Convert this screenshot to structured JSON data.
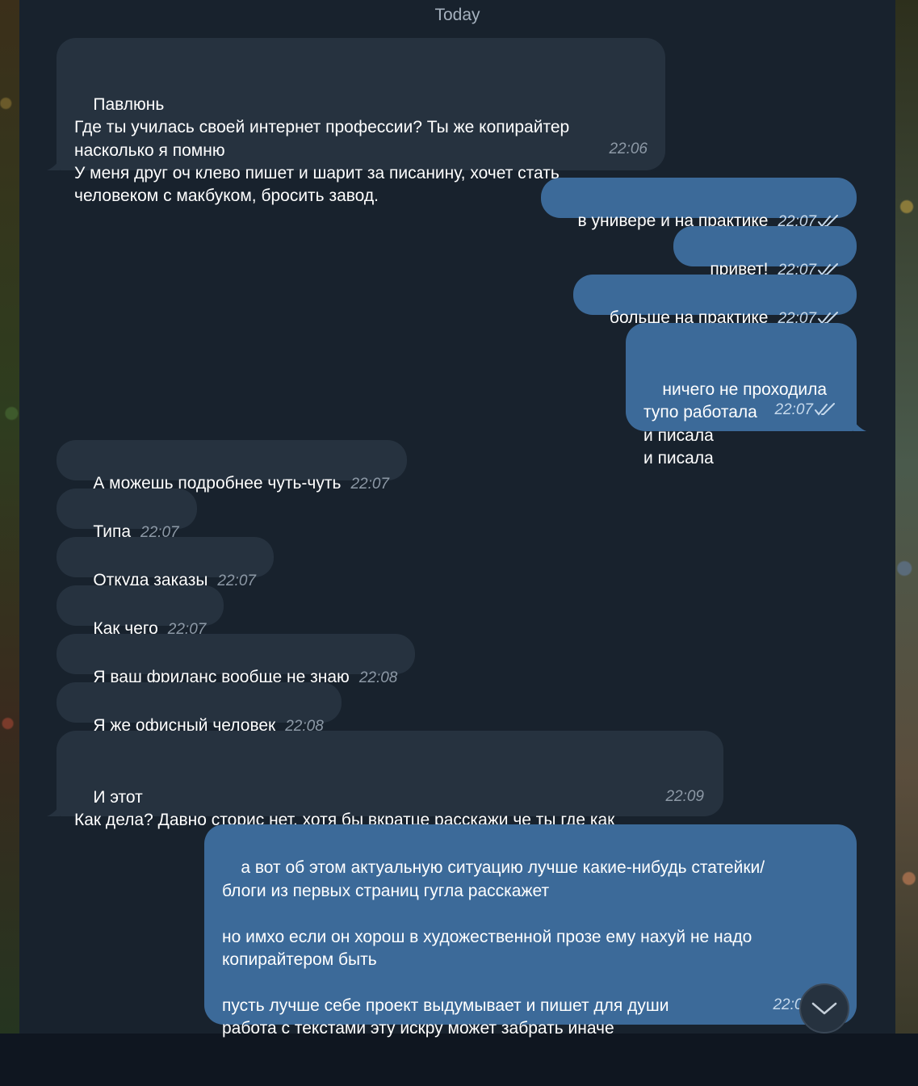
{
  "date_separator": "Today",
  "messages": [
    {
      "text": "Павлюнь\nГде ты училась своей интернет профессии? Ты же копирайтер насколько я помню\nУ меня друг оч клево пишет и шарит за писанину, хочет стать человеком с макбуком, бросить завод.",
      "time": "22:06"
    },
    {
      "text": "в универе и на практике",
      "time": "22:07"
    },
    {
      "text": "привет!",
      "time": "22:07"
    },
    {
      "text": "больше на практике",
      "time": "22:07"
    },
    {
      "text": "ничего не проходила\nтупо работала\nи писала\nи писала",
      "time": "22:07"
    },
    {
      "text": "А можешь подробнее чуть-чуть",
      "time": "22:07"
    },
    {
      "text": "Типа",
      "time": "22:07"
    },
    {
      "text": "Откуда заказы",
      "time": "22:07"
    },
    {
      "text": "Как чего",
      "time": "22:07"
    },
    {
      "text": "Я ваш фриланс вообще не знаю",
      "time": "22:08"
    },
    {
      "text": "Я же офисный человек",
      "time": "22:08"
    },
    {
      "text": "И этот\nКак дела? Давно сторис нет, хотя бы вкратце расскажи че ты где как",
      "time": "22:09"
    },
    {
      "text": "а вот об этом актуальную ситуацию лучше какие-нибудь статейки/\nблоги из первых страниц гугла расскажет\n\nно имхо если он хорош в художественной прозе ему нахуй не надо\nкопирайтером быть\n\nпусть лучше себе проект выдумывает и пишет для души\nработа с текстами эту искру может забрать иначе",
      "time": "22:09"
    }
  ],
  "colors": {
    "incoming_bubble": "#26323f",
    "outgoing_bubble": "#3c6a99",
    "chat_background": "#18222d"
  },
  "icons": {
    "read_receipt": "double-check-icon",
    "scroll_down": "chevron-down-icon"
  }
}
